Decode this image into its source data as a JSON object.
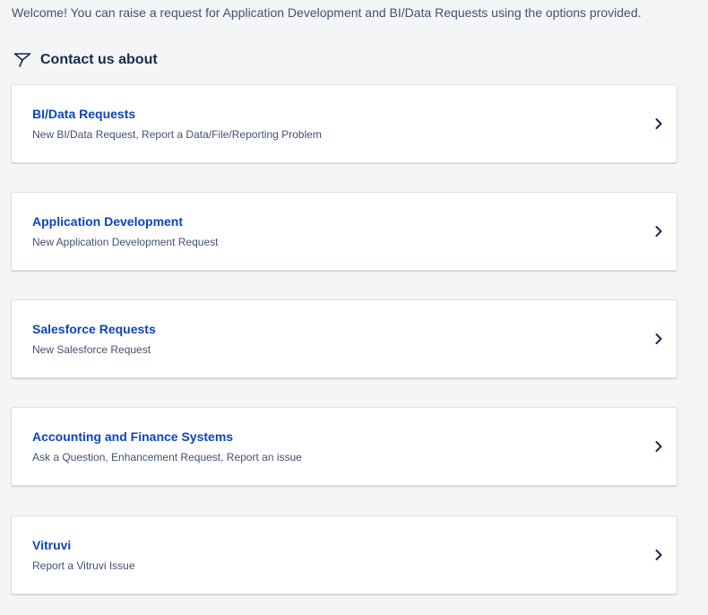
{
  "welcome_text": "Welcome! You can raise a request for Application Development and BI/Data Requests using the options provided.",
  "section": {
    "title": "Contact us about",
    "icon": "send-icon"
  },
  "colors": {
    "link": "#0e45b8",
    "text": "#172b4d",
    "subtle": "#42526e",
    "background": "#f4f5f7"
  },
  "cards": [
    {
      "title": "BI/Data Requests",
      "description": "New BI/Data Request, Report a Data/File/Reporting Problem",
      "icon": "chevron-right-icon"
    },
    {
      "title": "Application Development",
      "description": "New Application Development Request",
      "icon": "chevron-right-icon"
    },
    {
      "title": "Salesforce Requests",
      "description": "New Salesforce Request",
      "icon": "chevron-right-icon"
    },
    {
      "title": "Accounting and Finance Systems",
      "description": "Ask a Question, Enhancement Request, Report an issue",
      "icon": "chevron-right-icon"
    },
    {
      "title": "Vitruvi",
      "description": "Report a Vitruvi Issue",
      "icon": "chevron-right-icon"
    }
  ]
}
